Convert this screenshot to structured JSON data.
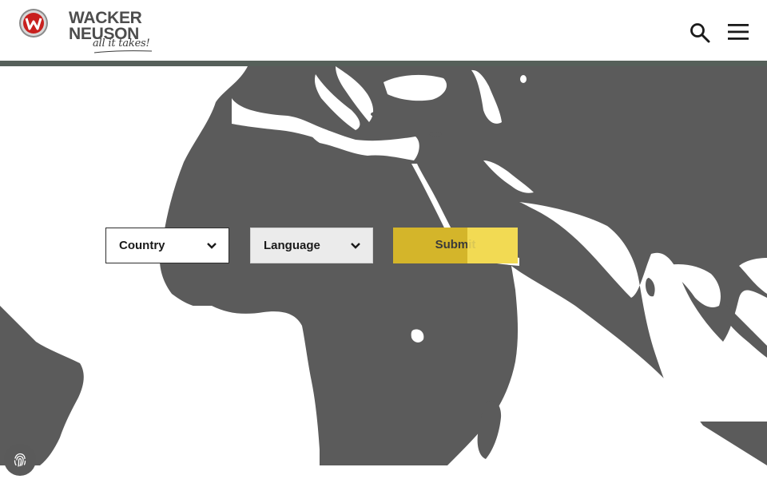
{
  "brand": {
    "line1": "WACKER",
    "line2": "NEUSON",
    "tagline": "all it takes!"
  },
  "header": {
    "icons": [
      "search-icon",
      "hamburger-menu-icon"
    ]
  },
  "form": {
    "country_label": "Country",
    "language_label": "Language",
    "submit_label": "Submit"
  },
  "colors": {
    "map_land": "#5b5b5b",
    "map_water": "#ffffff",
    "accent": "#d4b52a",
    "header_bar": "#56605a"
  },
  "privacy": {
    "icon": "fingerprint-icon"
  }
}
